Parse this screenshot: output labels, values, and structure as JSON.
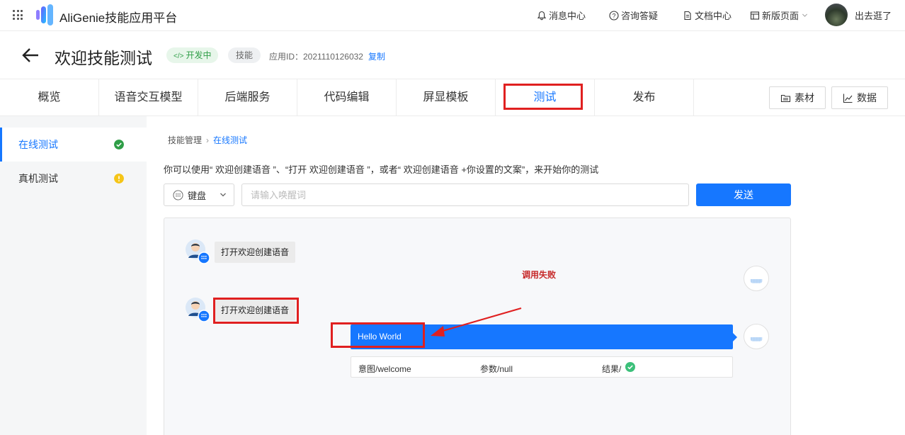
{
  "topbar": {
    "title": "AliGenie技能应用平台",
    "links": {
      "messages": "消息中心",
      "faq": "咨询答疑",
      "docs": "文档中心",
      "new_page": "新版页面"
    },
    "user_name": "出去逛了"
  },
  "skill": {
    "name": "欢迎技能测试",
    "status": "开发中",
    "type": "技能",
    "app_id_label": "应用ID：2021110126032",
    "copy_label": "复制"
  },
  "tabs": [
    "概览",
    "语音交互模型",
    "后端服务",
    "代码编辑",
    "屏显模板",
    "测试",
    "发布"
  ],
  "active_tab": "测试",
  "tab_buttons": {
    "materials": "素材",
    "data": "数据"
  },
  "sidebar": {
    "items": [
      {
        "label": "在线测试",
        "status_color": "#2f9e47"
      },
      {
        "label": "真机测试",
        "status_color": "#f5c518"
      }
    ]
  },
  "breadcrumb": {
    "parent": "技能管理",
    "current": "在线测试"
  },
  "hint": "你可以使用“ 欢迎创建语音 ”、“打开 欢迎创建语音 ”，或者“ 欢迎创建语音 +你设置的文案”，来开始你的测试",
  "input": {
    "mode": "键盘",
    "placeholder": "请输入唤醒词",
    "value": "",
    "send_label": "发送"
  },
  "chat": {
    "messages": [
      {
        "text": "打开欢迎创建语音"
      },
      {
        "text": "打开欢迎创建语音"
      }
    ],
    "error_text": "调用失败",
    "reply": "Hello World",
    "result": {
      "intent": "意图/welcome",
      "params": "参数/null",
      "result": "结果/"
    }
  },
  "colors": {
    "accent": "#1677ff",
    "highlight_box": "#e02020",
    "success": "#2f9e47",
    "warning": "#f5c518"
  }
}
